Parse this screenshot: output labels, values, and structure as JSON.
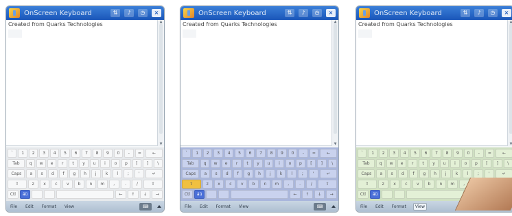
{
  "app": {
    "title": "OnScreen Keyboard",
    "document_text": "Created from Quarks Technologies"
  },
  "menubar": {
    "items": [
      "File",
      "Edit",
      "Format",
      "View"
    ]
  },
  "keyboard": {
    "rows": [
      [
        "`",
        "1",
        "2",
        "3",
        "4",
        "5",
        "6",
        "7",
        "8",
        "9",
        "0",
        "-",
        "=",
        "←"
      ],
      [
        "Tab",
        "q",
        "w",
        "e",
        "r",
        "t",
        "y",
        "u",
        "i",
        "o",
        "p",
        "[",
        "]",
        "\\"
      ],
      [
        "Caps",
        "a",
        "s",
        "d",
        "f",
        "g",
        "h",
        "j",
        "k",
        "l",
        ";",
        "'",
        "↵"
      ],
      [
        "⇧",
        "z",
        "x",
        "c",
        "v",
        "b",
        "n",
        "m",
        ",",
        ".",
        "/",
        "⇧"
      ],
      [
        "Ctl",
        "áü",
        "",
        "",
        "",
        "←",
        "↑",
        "↓",
        "→"
      ]
    ],
    "themes": [
      "#f7f8f9",
      "#c9d2ee",
      "#e3f0d6"
    ]
  }
}
